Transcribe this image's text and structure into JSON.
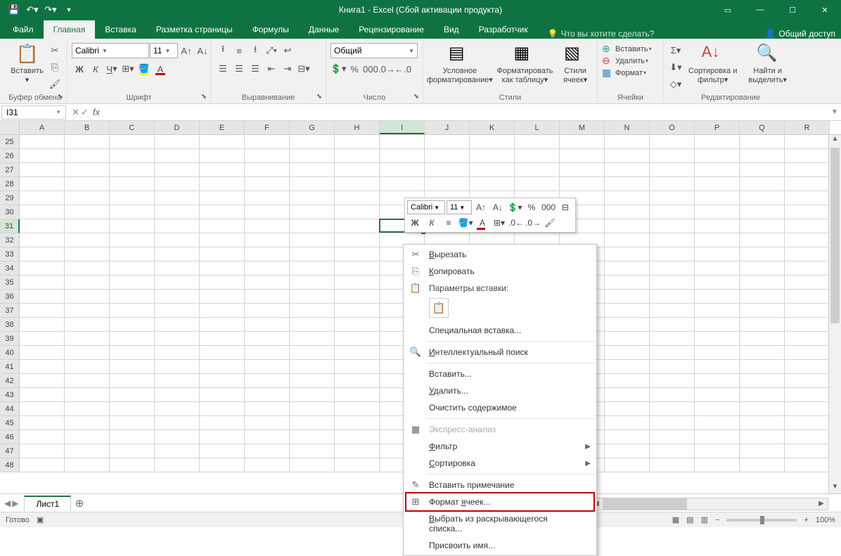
{
  "title": "Книга1 - Excel (Сбой активации продукта)",
  "qat_icons": [
    "save-icon",
    "undo-icon",
    "redo-icon"
  ],
  "window_buttons": [
    "ribbon-min-icon",
    "minimize-icon",
    "maximize-icon",
    "close-icon"
  ],
  "tabs": {
    "file": "Файл",
    "home": "Главная",
    "insert": "Вставка",
    "pagelayout": "Разметка страницы",
    "formulas": "Формулы",
    "data": "Данные",
    "review": "Рецензирование",
    "view": "Вид",
    "developer": "Разработчик"
  },
  "tellme": "Что вы хотите сделать?",
  "share": "Общий доступ",
  "ribbon": {
    "clipboard": {
      "label": "Буфер обмена",
      "paste": "Вставить"
    },
    "font": {
      "label": "Шрифт",
      "name": "Calibri",
      "size": "11"
    },
    "alignment": {
      "label": "Выравнивание"
    },
    "number": {
      "label": "Число",
      "format": "Общий"
    },
    "styles": {
      "label": "Стили",
      "condfmt": "Условное форматирование",
      "fmttable": "Форматировать как таблицу",
      "cellstyles": "Стили ячеек"
    },
    "cells": {
      "label": "Ячейки",
      "insert": "Вставить",
      "delete": "Удалить",
      "format": "Формат"
    },
    "editing": {
      "label": "Редактирование",
      "sort": "Сортировка и фильтр",
      "find": "Найти и выделить"
    }
  },
  "namebox": "I31",
  "columns": [
    "A",
    "B",
    "C",
    "D",
    "E",
    "F",
    "G",
    "H",
    "I",
    "J",
    "K",
    "L",
    "M",
    "N",
    "O",
    "P",
    "Q",
    "R"
  ],
  "selected_col": "I",
  "rows_start": 25,
  "rows_end": 48,
  "selected_row": 31,
  "mini_toolbar": {
    "font": "Calibri",
    "size": "11"
  },
  "context_menu": {
    "items": [
      {
        "id": "cut",
        "label": "Вырезать",
        "icon": "✂",
        "u": 0,
        "type": "item"
      },
      {
        "id": "copy",
        "label": "Копировать",
        "icon": "⎘",
        "u": 0,
        "type": "item"
      },
      {
        "id": "paste-options",
        "label": "Параметры вставки:",
        "icon": "📋",
        "type": "header"
      },
      {
        "id": "paste-default",
        "type": "paste-icon"
      },
      {
        "id": "paste-special",
        "label": "Специальная вставка...",
        "u": -1,
        "type": "item"
      },
      {
        "type": "sep"
      },
      {
        "id": "smart-lookup",
        "label": "Интеллектуальный поиск",
        "icon": "🔍",
        "u": 0,
        "type": "item"
      },
      {
        "type": "sep"
      },
      {
        "id": "insert",
        "label": "Вставить...",
        "type": "item"
      },
      {
        "id": "delete",
        "label": "Удалить...",
        "u": 0,
        "type": "item"
      },
      {
        "id": "clear",
        "label": "Очистить содержимое",
        "type": "item"
      },
      {
        "type": "sep"
      },
      {
        "id": "quick-analysis",
        "label": "Экспресс-анализ",
        "icon": "▦",
        "type": "item",
        "disabled": true
      },
      {
        "id": "filter",
        "label": "Фильтр",
        "u": 0,
        "type": "submenu"
      },
      {
        "id": "sort",
        "label": "Сортировка",
        "u": 0,
        "type": "submenu"
      },
      {
        "type": "sep"
      },
      {
        "id": "insert-comment",
        "label": "Вставить примечание",
        "icon": "✎",
        "type": "item"
      },
      {
        "id": "format-cells",
        "label": "Формат ячеек...",
        "icon": "⊞",
        "u": 7,
        "type": "item",
        "highlight": true
      },
      {
        "id": "dropdown-list",
        "label": "Выбрать из раскрывающегося списка...",
        "u": 0,
        "type": "item"
      },
      {
        "id": "define-name",
        "label": "Присвоить имя...",
        "type": "item"
      }
    ]
  },
  "sheets": {
    "active": "Лист1"
  },
  "status": {
    "ready": "Готово",
    "zoom": "100%"
  }
}
